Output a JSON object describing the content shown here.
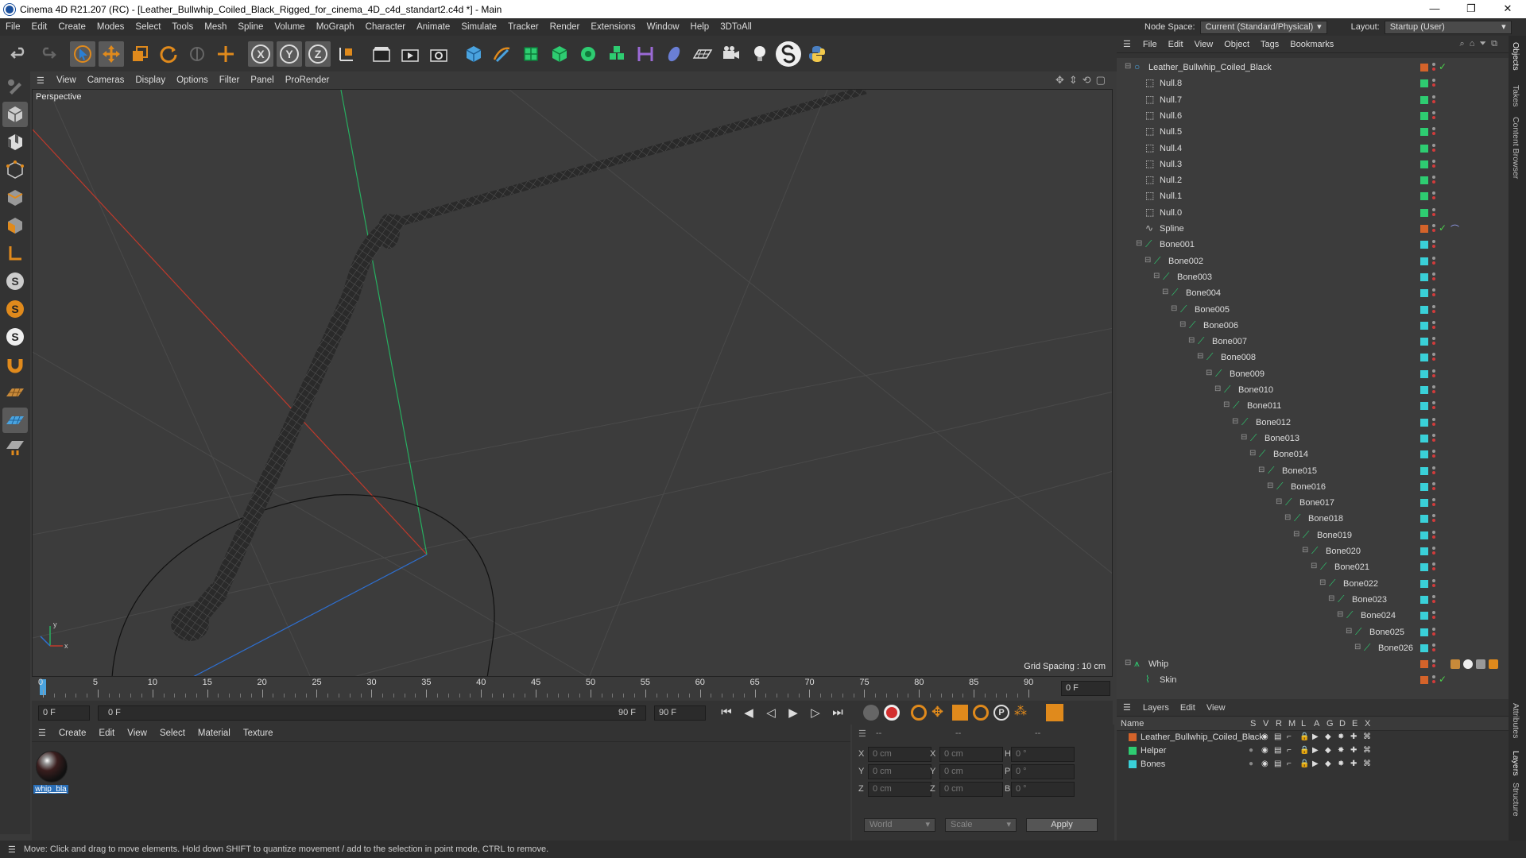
{
  "window": {
    "title": "Cinema 4D R21.207 (RC) - [Leather_Bullwhip_Coiled_Black_Rigged_for_cinema_4D_c4d_standart2.c4d *] - Main"
  },
  "menubar": {
    "items": [
      "File",
      "Edit",
      "Create",
      "Modes",
      "Select",
      "Tools",
      "Mesh",
      "Spline",
      "Volume",
      "MoGraph",
      "Character",
      "Animate",
      "Simulate",
      "Tracker",
      "Render",
      "Extensions",
      "Window",
      "Help",
      "3DToAll"
    ],
    "node_space_label": "Node Space:",
    "node_space_value": "Current (Standard/Physical)",
    "layout_label": "Layout:",
    "layout_value": "Startup (User)"
  },
  "viewport": {
    "menu": [
      "View",
      "Cameras",
      "Display",
      "Options",
      "Filter",
      "Panel",
      "ProRender"
    ],
    "label": "Perspective",
    "grid_spacing": "Grid Spacing : 10 cm"
  },
  "timeline": {
    "ticks": [
      "0",
      "5",
      "10",
      "15",
      "20",
      "25",
      "30",
      "35",
      "40",
      "45",
      "50",
      "55",
      "60",
      "65",
      "70",
      "75",
      "80",
      "85",
      "90"
    ],
    "current_frame": "0 F",
    "start_field": "0 F",
    "range_start": "0 F",
    "range_end": "90 F",
    "end_field": "90 F"
  },
  "material_panel": {
    "menu": [
      "Create",
      "Edit",
      "View",
      "Select",
      "Material",
      "Texture"
    ],
    "material_name": "whip_bla"
  },
  "coord_panel": {
    "header_cols": [
      "--",
      "--",
      "--"
    ],
    "rows": [
      {
        "a": "X",
        "av": "0 cm",
        "b": "X",
        "bv": "0 cm",
        "c": "H",
        "cv": "0 °"
      },
      {
        "a": "Y",
        "av": "0 cm",
        "b": "Y",
        "bv": "0 cm",
        "c": "P",
        "cv": "0 °"
      },
      {
        "a": "Z",
        "av": "0 cm",
        "b": "Z",
        "bv": "0 cm",
        "c": "B",
        "cv": "0 °"
      }
    ],
    "world": "World",
    "scale": "Scale",
    "apply": "Apply"
  },
  "object_panel": {
    "menu": [
      "File",
      "Edit",
      "View",
      "Object",
      "Tags",
      "Bookmarks"
    ],
    "root": "Leather_Bullwhip_Coiled_Black",
    "nulls": [
      "Null.8",
      "Null.7",
      "Null.6",
      "Null.5",
      "Null.4",
      "Null.3",
      "Null.2",
      "Null.1",
      "Null.0"
    ],
    "spline": "Spline",
    "bones": [
      "Bone001",
      "Bone002",
      "Bone003",
      "Bone004",
      "Bone005",
      "Bone006",
      "Bone007",
      "Bone008",
      "Bone009",
      "Bone010",
      "Bone011",
      "Bone012",
      "Bone013",
      "Bone014",
      "Bone015",
      "Bone016",
      "Bone017",
      "Bone018",
      "Bone019",
      "Bone020",
      "Bone021",
      "Bone022",
      "Bone023",
      "Bone024",
      "Bone025",
      "Bone026"
    ],
    "whip": "Whip",
    "skin": "Skin"
  },
  "layer_panel": {
    "menu": [
      "Layers",
      "Edit",
      "View"
    ],
    "name_header": "Name",
    "flag_headers": [
      "S",
      "V",
      "R",
      "M",
      "L",
      "A",
      "G",
      "D",
      "E",
      "X"
    ],
    "layers": [
      {
        "name": "Leather_Bullwhip_Coiled_Black",
        "color": "#d4632a"
      },
      {
        "name": "Helper",
        "color": "#2ecc71"
      },
      {
        "name": "Bones",
        "color": "#3ad0d8"
      }
    ]
  },
  "side_tabs": [
    "Objects",
    "Takes",
    "Content Browser",
    "Attributes",
    "Layers",
    "Structure"
  ],
  "status": {
    "text": "Move: Click and drag to move elements. Hold down SHIFT to quantize movement / add to the selection in point mode, CTRL to remove."
  },
  "colors": {
    "null_swatch": "#2ecc71",
    "bone_swatch": "#3ad0d8",
    "root_swatch": "#d4632a",
    "axis_x": "#c0392b",
    "axis_y": "#27ae60",
    "axis_z": "#2e6fd0"
  }
}
